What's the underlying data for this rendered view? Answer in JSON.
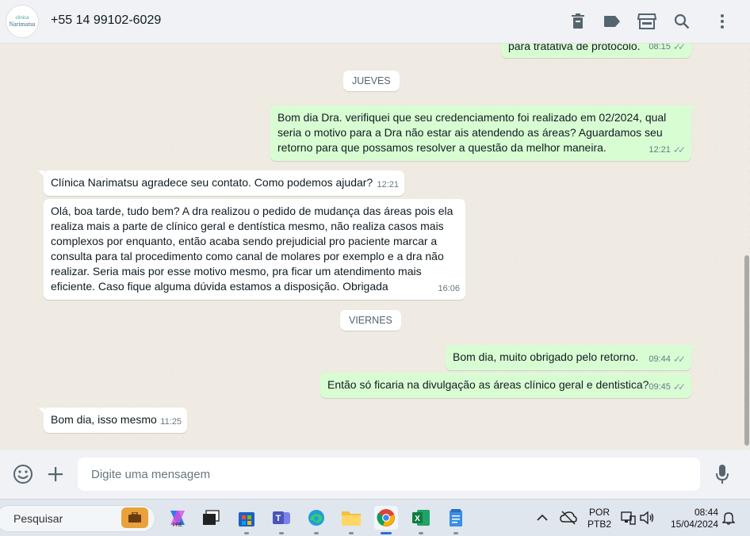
{
  "header": {
    "contact_name": "+55 14 99102-6029",
    "avatar_logo_small": "clínica",
    "avatar_logo_text": "Narimatsu",
    "icons": [
      "trash-icon",
      "label-icon",
      "store-icon",
      "search-icon",
      "more-icon"
    ]
  },
  "chat": {
    "top_partial": {
      "text": "para tratativa de protocolo.",
      "time": "08:15"
    },
    "day_jueves": "JUEVES",
    "msg_out_1": {
      "text": "Bom dia Dra. verifiquei que seu credenciamento foi realizado em 02/2024, qual seria o motivo para a Dra não estar ais atendendo as áreas? Aguardamos seu retorno para que possamos resolver a questão da melhor maneira.",
      "time": "12:21"
    },
    "msg_in_1": {
      "text": "Clínica Narimatsu agradece seu contato. Como podemos ajudar?",
      "time": "12:21"
    },
    "msg_in_2": {
      "text": "Olá, boa tarde, tudo bem? A dra realizou o pedido de mudança das áreas pois ela realiza mais a parte de clínico geral e dentística mesmo, não realiza casos mais complexos por enquanto, então acaba sendo prejudicial pro paciente marcar a consulta para tal procedimento como canal de molares por exemplo e a dra não realizar. Seria mais por esse motivo mesmo, pra ficar um atendimento mais eficiente. Caso fique alguma dúvida estamos a disposição. Obrigada",
      "time": "16:06"
    },
    "day_viernes": "VIERNES",
    "msg_out_2": {
      "text": "Bom dia, muito obrigado pelo retorno.",
      "time": "09:44"
    },
    "msg_out_3": {
      "text": "Então só ficaria na divulgação as áreas clínico geral e dentistica?",
      "time": "09:45"
    },
    "msg_in_3": {
      "text": "Bom dia, isso mesmo",
      "time": "11:25"
    }
  },
  "composer": {
    "placeholder": "Digite uma mensagem",
    "icons": [
      "emoji-icon",
      "plus-icon",
      "microphone-icon"
    ]
  },
  "taskbar": {
    "search_placeholder": "Pesquisar",
    "apps": [
      "briefcase-icon",
      "copilot-icon",
      "task-view-icon",
      "store-icon",
      "teams-icon",
      "edge-icon",
      "file-explorer-icon",
      "chrome-icon",
      "excel-icon",
      "notepad-icon"
    ],
    "lang_top": "POR",
    "lang_bottom": "PTB2",
    "time": "08:44",
    "date": "15/04/2024"
  },
  "colors": {
    "outgoing_bubble": "#d9fdd3",
    "incoming_bubble": "#ffffff",
    "chat_background": "#efeae2",
    "header_background": "#f0f2f5",
    "taskbar_background": "#dfe6ee"
  }
}
